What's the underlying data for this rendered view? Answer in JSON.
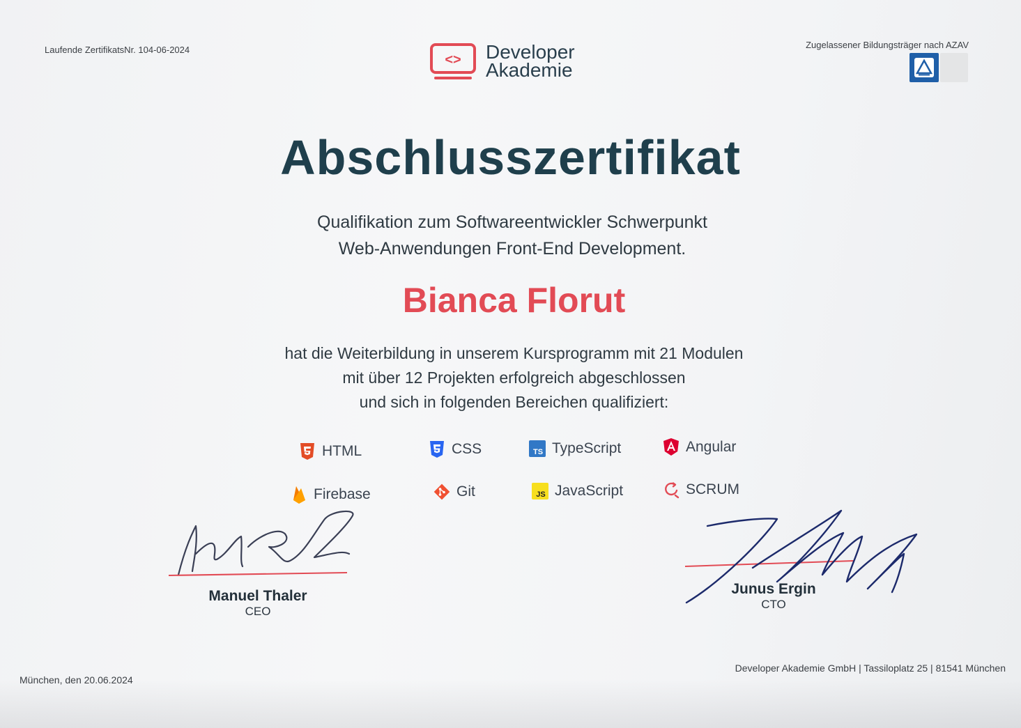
{
  "header": {
    "certificate_number": "Laufende ZertifikatsNr. 104-06-2024",
    "azav_label": "Zugelassener Bildungsträger nach AZAV"
  },
  "logo": {
    "symbol": "<>",
    "line1": "Developer",
    "line2": "Akademie"
  },
  "title": "Abschlusszertifikat",
  "subtitle": {
    "line1": "Qualifikation zum Softwareentwickler Schwerpunkt",
    "line2": "Web-Anwendungen Front-End Development."
  },
  "recipient": "Bianca Florut",
  "body": {
    "line1": "hat die Weiterbildung in unserem Kursprogramm mit 21 Modulen",
    "line2": "mit über 12 Projekten erfolgreich abgeschlossen",
    "line3": "und sich in folgenden Bereichen qualifiziert:"
  },
  "skills": [
    {
      "label": "HTML",
      "icon": "html5-icon",
      "color": "#e34c26"
    },
    {
      "label": "CSS",
      "icon": "css3-icon",
      "color": "#2965f1"
    },
    {
      "label": "TypeScript",
      "icon": "typescript-icon",
      "color": "#3178c6"
    },
    {
      "label": "Angular",
      "icon": "angular-icon",
      "color": "#dd0031"
    },
    {
      "label": "Firebase",
      "icon": "firebase-icon",
      "color": "#ffa000"
    },
    {
      "label": "Git",
      "icon": "git-icon",
      "color": "#f05032"
    },
    {
      "label": "JavaScript",
      "icon": "javascript-icon",
      "color": "#f7df1e"
    },
    {
      "label": "SCRUM",
      "icon": "scrum-icon",
      "color": "#e24b55"
    }
  ],
  "skill_badges": {
    "typescript": "TS",
    "javascript": "JS"
  },
  "signatures": [
    {
      "name": "Manuel Thaler",
      "role": "CEO"
    },
    {
      "name": "Junus Ergin",
      "role": "CTO"
    }
  ],
  "footer": {
    "date": "München, den 20.06.2024",
    "address": "Developer Akademie GmbH | Tassiloplatz 25 | 81541 München"
  },
  "colors": {
    "title": "#1f3f4c",
    "accent": "#e24b55",
    "signature_ink": "#1c2a6b"
  }
}
